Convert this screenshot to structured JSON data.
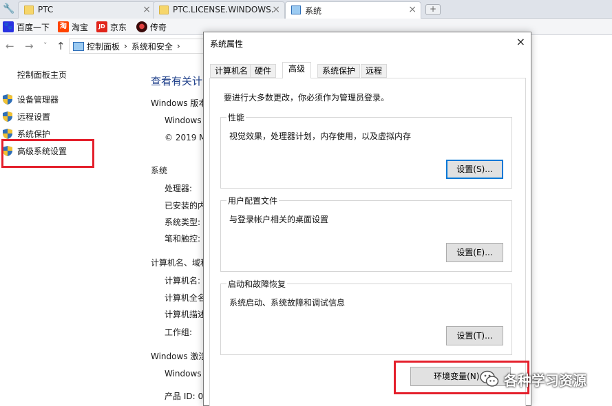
{
  "browser": {
    "tabs": [
      {
        "title": "PTC",
        "icon": "folder-icon"
      },
      {
        "title": "PTC.LICENSE.WINDOWS.",
        "icon": "folder-icon"
      },
      {
        "title": "系统",
        "icon": "monitor-icon",
        "active": true
      }
    ],
    "new_tab_symbol": "+",
    "close_symbol": "×"
  },
  "bookmarks": [
    {
      "label": "百度一下",
      "icon": "baidu-paw-icon",
      "color": "#2932e1",
      "glyph": "🐾"
    },
    {
      "label": "淘宝",
      "icon": "taobao-icon",
      "color": "#ff4400",
      "glyph": "淘"
    },
    {
      "label": "京东",
      "icon": "jd-icon",
      "color": "#e1251b",
      "glyph": "JD"
    },
    {
      "label": "传奇",
      "icon": "legend-game-icon",
      "color": "#b01010",
      "glyph": "●"
    }
  ],
  "address": {
    "back": "←",
    "forward": "→",
    "recent": "˅",
    "up": "↑",
    "breadcrumbs": [
      "控制面板",
      "›",
      "系统和安全",
      "›"
    ]
  },
  "left_nav": {
    "home": "控制面板主页",
    "items": [
      {
        "label": "设备管理器"
      },
      {
        "label": "远程设置"
      },
      {
        "label": "系统保护"
      },
      {
        "label": "高级系统设置"
      }
    ]
  },
  "main_panel": {
    "title": "查看有关计",
    "windows_edition": "Windows 版本",
    "windows_line": "Windows",
    "copyright": "© 2019 M",
    "system_heading": "系统",
    "processor": "处理器:",
    "installed_memory": "已安装的内",
    "system_type": "系统类型:",
    "pen_touch": "笔和触控:",
    "computer_name_heading": "计算机名、域和",
    "computer_name": "计算机名:",
    "full_computer_name": "计算机全名",
    "computer_description": "计算机描述",
    "workgroup": "工作组:",
    "activation_heading": "Windows 激活",
    "activation_line": "Windows",
    "product_id": "产品 ID: 0"
  },
  "dialog": {
    "title": "系统属性",
    "close": "×",
    "tabs": [
      "计算机名",
      "硬件",
      "高级",
      "系统保护",
      "远程"
    ],
    "active_tab": "高级",
    "admin_note": "要进行大多数更改，你必须作为管理员登录。",
    "performance": {
      "label": "性能",
      "description": "视觉效果，处理器计划，内存使用，以及虚拟内存",
      "button": "设置(S)..."
    },
    "user_profiles": {
      "label": "用户配置文件",
      "description": "与登录帐户相关的桌面设置",
      "button": "设置(E)..."
    },
    "startup_recovery": {
      "label": "启动和故障恢复",
      "description": "系统启动、系统故障和调试信息",
      "button": "设置(T)..."
    },
    "env_button": "环境变量(N)..."
  },
  "highlight_color": "#e4202c",
  "watermark": {
    "text": "各种学习资源",
    "icon": "wechat-icon"
  }
}
